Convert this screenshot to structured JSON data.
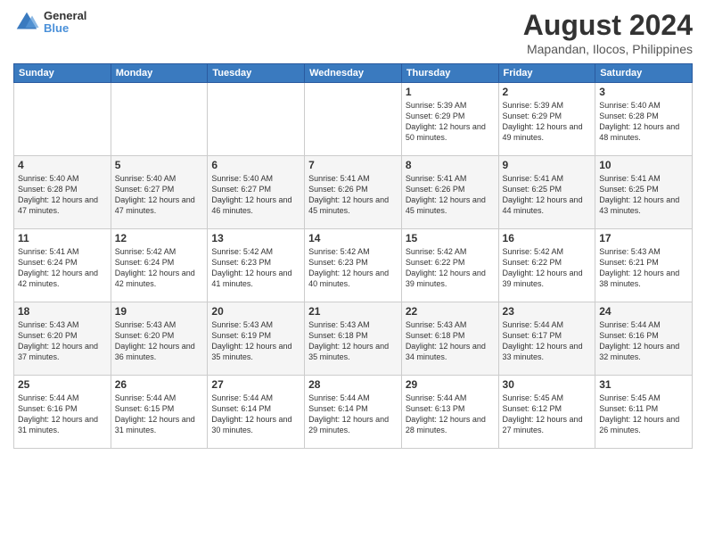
{
  "header": {
    "logo": {
      "general": "General",
      "blue": "Blue"
    },
    "title": "August 2024",
    "location": "Mapandan, Ilocos, Philippines"
  },
  "days_of_week": [
    "Sunday",
    "Monday",
    "Tuesday",
    "Wednesday",
    "Thursday",
    "Friday",
    "Saturday"
  ],
  "weeks": [
    [
      {
        "day": "",
        "sunrise": "",
        "sunset": "",
        "daylight": ""
      },
      {
        "day": "",
        "sunrise": "",
        "sunset": "",
        "daylight": ""
      },
      {
        "day": "",
        "sunrise": "",
        "sunset": "",
        "daylight": ""
      },
      {
        "day": "",
        "sunrise": "",
        "sunset": "",
        "daylight": ""
      },
      {
        "day": "1",
        "sunrise": "Sunrise: 5:39 AM",
        "sunset": "Sunset: 6:29 PM",
        "daylight": "Daylight: 12 hours and 50 minutes."
      },
      {
        "day": "2",
        "sunrise": "Sunrise: 5:39 AM",
        "sunset": "Sunset: 6:29 PM",
        "daylight": "Daylight: 12 hours and 49 minutes."
      },
      {
        "day": "3",
        "sunrise": "Sunrise: 5:40 AM",
        "sunset": "Sunset: 6:28 PM",
        "daylight": "Daylight: 12 hours and 48 minutes."
      }
    ],
    [
      {
        "day": "4",
        "sunrise": "Sunrise: 5:40 AM",
        "sunset": "Sunset: 6:28 PM",
        "daylight": "Daylight: 12 hours and 47 minutes."
      },
      {
        "day": "5",
        "sunrise": "Sunrise: 5:40 AM",
        "sunset": "Sunset: 6:27 PM",
        "daylight": "Daylight: 12 hours and 47 minutes."
      },
      {
        "day": "6",
        "sunrise": "Sunrise: 5:40 AM",
        "sunset": "Sunset: 6:27 PM",
        "daylight": "Daylight: 12 hours and 46 minutes."
      },
      {
        "day": "7",
        "sunrise": "Sunrise: 5:41 AM",
        "sunset": "Sunset: 6:26 PM",
        "daylight": "Daylight: 12 hours and 45 minutes."
      },
      {
        "day": "8",
        "sunrise": "Sunrise: 5:41 AM",
        "sunset": "Sunset: 6:26 PM",
        "daylight": "Daylight: 12 hours and 45 minutes."
      },
      {
        "day": "9",
        "sunrise": "Sunrise: 5:41 AM",
        "sunset": "Sunset: 6:25 PM",
        "daylight": "Daylight: 12 hours and 44 minutes."
      },
      {
        "day": "10",
        "sunrise": "Sunrise: 5:41 AM",
        "sunset": "Sunset: 6:25 PM",
        "daylight": "Daylight: 12 hours and 43 minutes."
      }
    ],
    [
      {
        "day": "11",
        "sunrise": "Sunrise: 5:41 AM",
        "sunset": "Sunset: 6:24 PM",
        "daylight": "Daylight: 12 hours and 42 minutes."
      },
      {
        "day": "12",
        "sunrise": "Sunrise: 5:42 AM",
        "sunset": "Sunset: 6:24 PM",
        "daylight": "Daylight: 12 hours and 42 minutes."
      },
      {
        "day": "13",
        "sunrise": "Sunrise: 5:42 AM",
        "sunset": "Sunset: 6:23 PM",
        "daylight": "Daylight: 12 hours and 41 minutes."
      },
      {
        "day": "14",
        "sunrise": "Sunrise: 5:42 AM",
        "sunset": "Sunset: 6:23 PM",
        "daylight": "Daylight: 12 hours and 40 minutes."
      },
      {
        "day": "15",
        "sunrise": "Sunrise: 5:42 AM",
        "sunset": "Sunset: 6:22 PM",
        "daylight": "Daylight: 12 hours and 39 minutes."
      },
      {
        "day": "16",
        "sunrise": "Sunrise: 5:42 AM",
        "sunset": "Sunset: 6:22 PM",
        "daylight": "Daylight: 12 hours and 39 minutes."
      },
      {
        "day": "17",
        "sunrise": "Sunrise: 5:43 AM",
        "sunset": "Sunset: 6:21 PM",
        "daylight": "Daylight: 12 hours and 38 minutes."
      }
    ],
    [
      {
        "day": "18",
        "sunrise": "Sunrise: 5:43 AM",
        "sunset": "Sunset: 6:20 PM",
        "daylight": "Daylight: 12 hours and 37 minutes."
      },
      {
        "day": "19",
        "sunrise": "Sunrise: 5:43 AM",
        "sunset": "Sunset: 6:20 PM",
        "daylight": "Daylight: 12 hours and 36 minutes."
      },
      {
        "day": "20",
        "sunrise": "Sunrise: 5:43 AM",
        "sunset": "Sunset: 6:19 PM",
        "daylight": "Daylight: 12 hours and 35 minutes."
      },
      {
        "day": "21",
        "sunrise": "Sunrise: 5:43 AM",
        "sunset": "Sunset: 6:18 PM",
        "daylight": "Daylight: 12 hours and 35 minutes."
      },
      {
        "day": "22",
        "sunrise": "Sunrise: 5:43 AM",
        "sunset": "Sunset: 6:18 PM",
        "daylight": "Daylight: 12 hours and 34 minutes."
      },
      {
        "day": "23",
        "sunrise": "Sunrise: 5:44 AM",
        "sunset": "Sunset: 6:17 PM",
        "daylight": "Daylight: 12 hours and 33 minutes."
      },
      {
        "day": "24",
        "sunrise": "Sunrise: 5:44 AM",
        "sunset": "Sunset: 6:16 PM",
        "daylight": "Daylight: 12 hours and 32 minutes."
      }
    ],
    [
      {
        "day": "25",
        "sunrise": "Sunrise: 5:44 AM",
        "sunset": "Sunset: 6:16 PM",
        "daylight": "Daylight: 12 hours and 31 minutes."
      },
      {
        "day": "26",
        "sunrise": "Sunrise: 5:44 AM",
        "sunset": "Sunset: 6:15 PM",
        "daylight": "Daylight: 12 hours and 31 minutes."
      },
      {
        "day": "27",
        "sunrise": "Sunrise: 5:44 AM",
        "sunset": "Sunset: 6:14 PM",
        "daylight": "Daylight: 12 hours and 30 minutes."
      },
      {
        "day": "28",
        "sunrise": "Sunrise: 5:44 AM",
        "sunset": "Sunset: 6:14 PM",
        "daylight": "Daylight: 12 hours and 29 minutes."
      },
      {
        "day": "29",
        "sunrise": "Sunrise: 5:44 AM",
        "sunset": "Sunset: 6:13 PM",
        "daylight": "Daylight: 12 hours and 28 minutes."
      },
      {
        "day": "30",
        "sunrise": "Sunrise: 5:45 AM",
        "sunset": "Sunset: 6:12 PM",
        "daylight": "Daylight: 12 hours and 27 minutes."
      },
      {
        "day": "31",
        "sunrise": "Sunrise: 5:45 AM",
        "sunset": "Sunset: 6:11 PM",
        "daylight": "Daylight: 12 hours and 26 minutes."
      }
    ]
  ]
}
